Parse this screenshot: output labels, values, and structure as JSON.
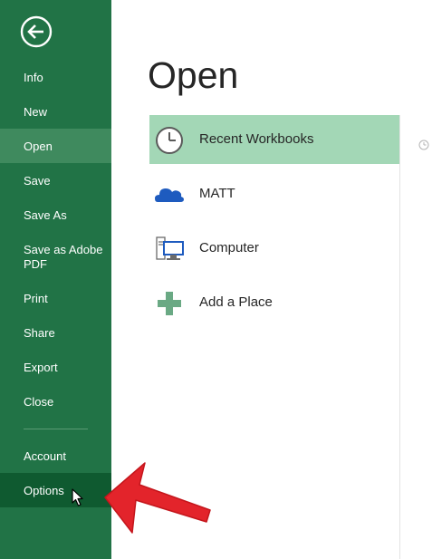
{
  "sidebar": {
    "back_icon": "back-arrow-icon",
    "items": [
      {
        "label": "Info"
      },
      {
        "label": "New"
      },
      {
        "label": "Open",
        "selected": true
      },
      {
        "label": "Save"
      },
      {
        "label": "Save As"
      },
      {
        "label": "Save as Adobe PDF"
      },
      {
        "label": "Print"
      },
      {
        "label": "Share"
      },
      {
        "label": "Export"
      },
      {
        "label": "Close"
      },
      {
        "label": "Account"
      },
      {
        "label": "Options",
        "hovered": true
      }
    ]
  },
  "main": {
    "title": "Open",
    "places": [
      {
        "label": "Recent Workbooks",
        "icon": "clock-icon",
        "selected": true
      },
      {
        "label": "MATT",
        "icon": "onedrive-cloud-icon"
      },
      {
        "label": "Computer",
        "icon": "computer-icon"
      },
      {
        "label": "Add a Place",
        "icon": "plus-icon"
      }
    ]
  },
  "colors": {
    "sidebar_bg": "#217346",
    "sidebar_selected": "#3f8a5e",
    "sidebar_hover": "#0f5a30",
    "place_selected": "#a3d7b6",
    "annotation_arrow": "#e3242b"
  }
}
